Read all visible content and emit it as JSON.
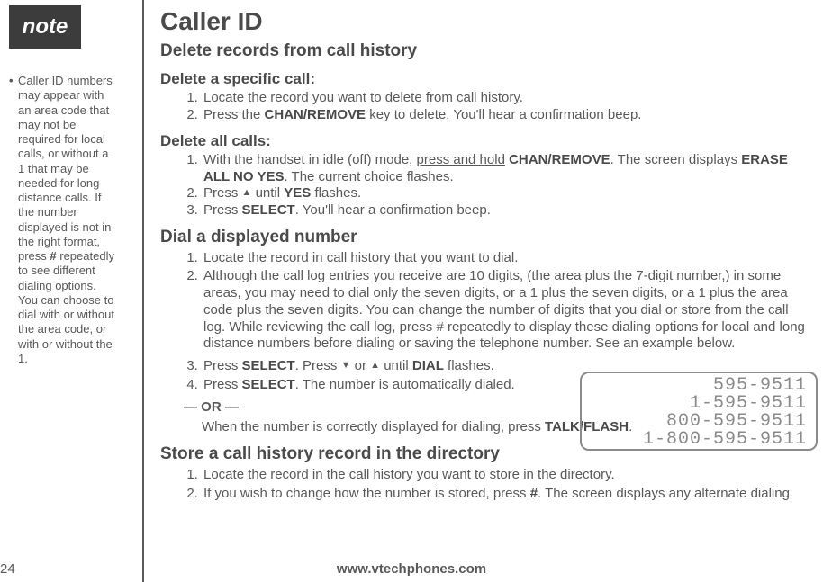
{
  "note": {
    "label": "note",
    "body_pre": "Caller ID numbers may appear with an area code that may not be required for local calls, or without a 1 that may be needed for long distance calls. If the number displayed is not in the right format, press ",
    "hash": "#",
    "body_post": " repeatedly to see different dialing options. You can choose to dial with or without the area code, or with or without the 1."
  },
  "title": "Caller ID",
  "subtitle": "Delete records from call history",
  "del_specific": {
    "heading": "Delete a specific call:",
    "s1": "Locate the record you want to delete from call history.",
    "s2_a": "Press the ",
    "s2_key": "CHAN/REMOVE",
    "s2_b": " key to delete. You'll hear a confirmation beep."
  },
  "del_all": {
    "heading": "Delete all calls:",
    "s1_a": "With the handset in idle (off) mode, ",
    "s1_u": "press and hold",
    "s1_b": " ",
    "s1_key": "CHAN/REMOVE",
    "s1_c": ". The screen displays ",
    "s1_erase": "ERASE ALL NO YES",
    "s1_d": ". The current choice flashes.",
    "s2_a": "Press ",
    "s2_b": " until ",
    "s2_yes": "YES",
    "s2_c": " flashes.",
    "s3_a": "Press ",
    "s3_key": "SELECT",
    "s3_b": ". You'll hear a confirmation beep."
  },
  "dial": {
    "heading": "Dial a displayed number",
    "s1": "Locate the record in call history that you want to dial.",
    "s2": "Although the call log entries you receive are 10 digits, (the area plus the 7-digit number,) in some areas, you may need to dial only the seven digits, or a 1 plus the seven digits, or a 1 plus the area code plus the seven digits. You can change the number of digits that you dial or store from the call log. While reviewing the call log, press # repeatedly to display these dialing options for local and long distance numbers before dialing or saving the telephone number. See an example below.",
    "s3_a": "Press ",
    "s3_key1": "SELECT",
    "s3_b": ". Press ",
    "s3_c": " or ",
    "s3_d": " until ",
    "s3_dial": "DIAL",
    "s3_e": " flashes.",
    "s4_a": "Press ",
    "s4_key": "SELECT",
    "s4_b": ". The number is automatically dialed.",
    "or": "—  OR  —",
    "s5_a": "When the number is correctly displayed for dialing, press ",
    "s5_key": "TALK/FLASH",
    "s5_b": "."
  },
  "store": {
    "heading": "Store a call history record in the directory",
    "s1": "Locate the record in the call history you want to store in the directory.",
    "s2_a": " If you wish to change how the number is stored, press ",
    "s2_hash": "#",
    "s2_b": ". The screen displays any alternate dialing"
  },
  "display": {
    "l1": "595-9511",
    "l2": "1-595-9511",
    "l3": "800-595-9511",
    "l4": "1-800-595-9511"
  },
  "page_number": "24",
  "footer": "www.vtechphones.com",
  "arrows": {
    "up": "▲",
    "down": "▼"
  }
}
